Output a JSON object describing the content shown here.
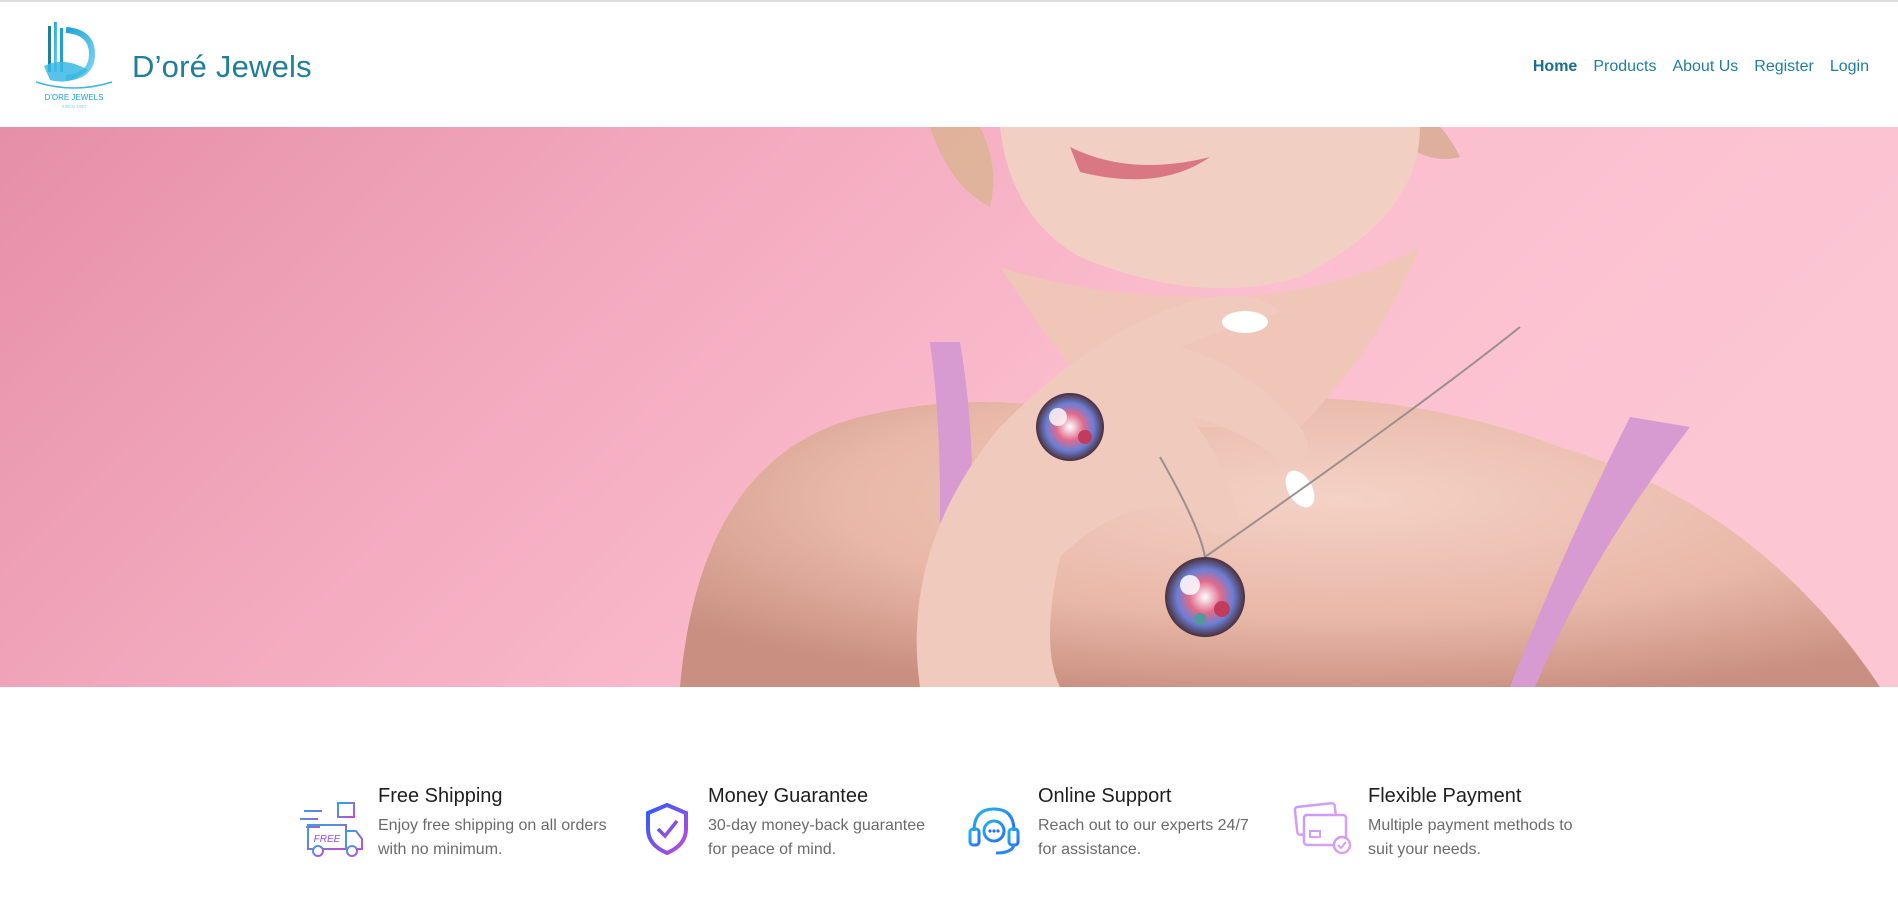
{
  "header": {
    "brand_name": "D’oré Jewels",
    "logo_text": "D'ORE JEWELS",
    "logo_subtext": "SINCE 1997",
    "nav": [
      {
        "label": "Home",
        "active": true
      },
      {
        "label": "Products",
        "active": false
      },
      {
        "label": "About Us",
        "active": false
      },
      {
        "label": "Register",
        "active": false
      },
      {
        "label": "Login",
        "active": false
      }
    ]
  },
  "hero": {
    "image_subject": "model wearing gemstone ring and pendant necklace on pink background"
  },
  "features": [
    {
      "icon": "delivery-truck-icon",
      "title": "Free Shipping",
      "line1": "Enjoy free shipping on all orders",
      "line2": "with no minimum.",
      "icon_badge": "FREE"
    },
    {
      "icon": "shield-check-icon",
      "title": "Money Guarantee",
      "line1": "30-day money-back guarantee",
      "line2": "for peace of mind."
    },
    {
      "icon": "headset-support-icon",
      "title": "Online Support",
      "line1": "Reach out to our experts 24/7",
      "line2": "for assistance."
    },
    {
      "icon": "credit-card-icon",
      "title": "Flexible Payment",
      "line1": "Multiple payment methods to",
      "line2": "suit your needs."
    }
  ],
  "colors": {
    "brand": "#1d7f9b",
    "hero_pink": "#f6b3c4",
    "feature_icon_purple": "#8a4dff",
    "feature_icon_blue": "#2aa7e0"
  }
}
